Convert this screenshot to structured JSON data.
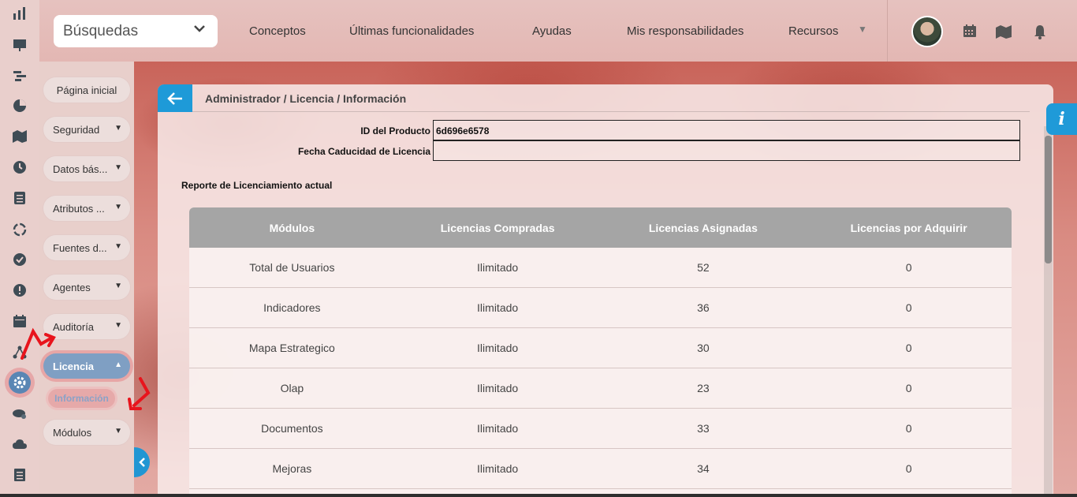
{
  "search": {
    "label": "Búsquedas"
  },
  "nav": {
    "items": [
      "Conceptos",
      "Últimas funcionalidades",
      "Ayudas",
      "Mis responsabilidades",
      "Recursos"
    ]
  },
  "icons": {
    "top": [
      "calendar-icon",
      "map-icon",
      "bell-icon"
    ],
    "rail": [
      "bar-chart-icon",
      "presentation-icon",
      "gantt-icon",
      "pie-chart-icon",
      "map-icon",
      "clock-icon",
      "list-icon",
      "cycle-icon",
      "check-icon",
      "warning-icon",
      "calendar-icon",
      "graph-icon",
      "gear-icon",
      "cloud-gear-icon",
      "cloud-icon",
      "document-list-icon"
    ]
  },
  "menu": {
    "home": "Página inicial",
    "items": [
      "Seguridad",
      "Datos bás...",
      "Atributos ...",
      "Fuentes d...",
      "Agentes",
      "Auditoría",
      "Licencia",
      "Módulos"
    ],
    "sub_item": "Información"
  },
  "breadcrumb": "Administrador / Licencia / Información",
  "fields": {
    "product_id_label": "ID del Producto",
    "product_id_value": "6d696e6578",
    "expiry_label": "Fecha Caducidad de Licencia",
    "expiry_value": ""
  },
  "report_title": "Reporte de Licenciamiento actual",
  "table": {
    "headers": [
      "Módulos",
      "Licencias Compradas",
      "Licencias Asignadas",
      "Licencias por Adquirir"
    ],
    "rows": [
      [
        "Total de Usuarios",
        "Ilimitado",
        "52",
        "0"
      ],
      [
        "Indicadores",
        "Ilimitado",
        "36",
        "0"
      ],
      [
        "Mapa Estrategico",
        "Ilimitado",
        "30",
        "0"
      ],
      [
        "Olap",
        "Ilimitado",
        "23",
        "0"
      ],
      [
        "Documentos",
        "Ilimitado",
        "33",
        "0"
      ],
      [
        "Mejoras",
        "Ilimitado",
        "34",
        "0"
      ]
    ]
  },
  "colors": {
    "accent": "#1e9ad8",
    "active_menu": "#7f9fc3",
    "annotation_arrow": "#e8141c"
  }
}
